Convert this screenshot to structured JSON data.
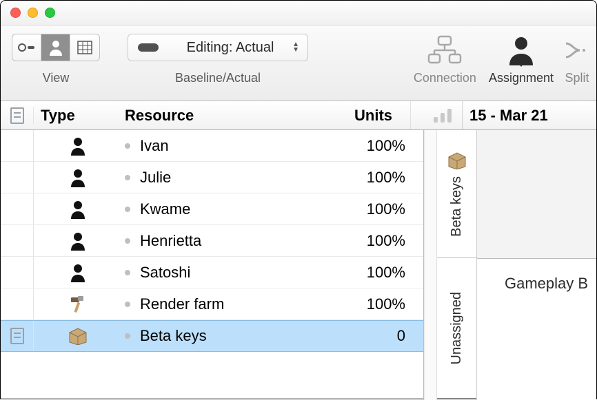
{
  "toolbar": {
    "view_label": "View",
    "baseline_label": "Baseline/Actual",
    "dropdown_label": "Editing: Actual",
    "connection_label": "Connection",
    "assignment_label": "Assignment",
    "split_label": "Split"
  },
  "columns": {
    "type": "Type",
    "resource": "Resource",
    "units": "Units"
  },
  "rows": [
    {
      "icon": "person",
      "name": "Ivan",
      "units": "100%",
      "selected": false
    },
    {
      "icon": "person",
      "name": "Julie",
      "units": "100%",
      "selected": false
    },
    {
      "icon": "person",
      "name": "Kwame",
      "units": "100%",
      "selected": false
    },
    {
      "icon": "person",
      "name": "Henrietta",
      "units": "100%",
      "selected": false
    },
    {
      "icon": "person",
      "name": "Satoshi",
      "units": "100%",
      "selected": false
    },
    {
      "icon": "hammer",
      "name": "Render farm",
      "units": "100%",
      "selected": false
    },
    {
      "icon": "box",
      "name": "Beta keys",
      "units": "0",
      "selected": true
    }
  ],
  "timeline": {
    "date_label": "15 - Mar 21",
    "lane1_label": "Beta keys",
    "lane2_label": "Unassigned",
    "task_label": "Gameplay B"
  }
}
